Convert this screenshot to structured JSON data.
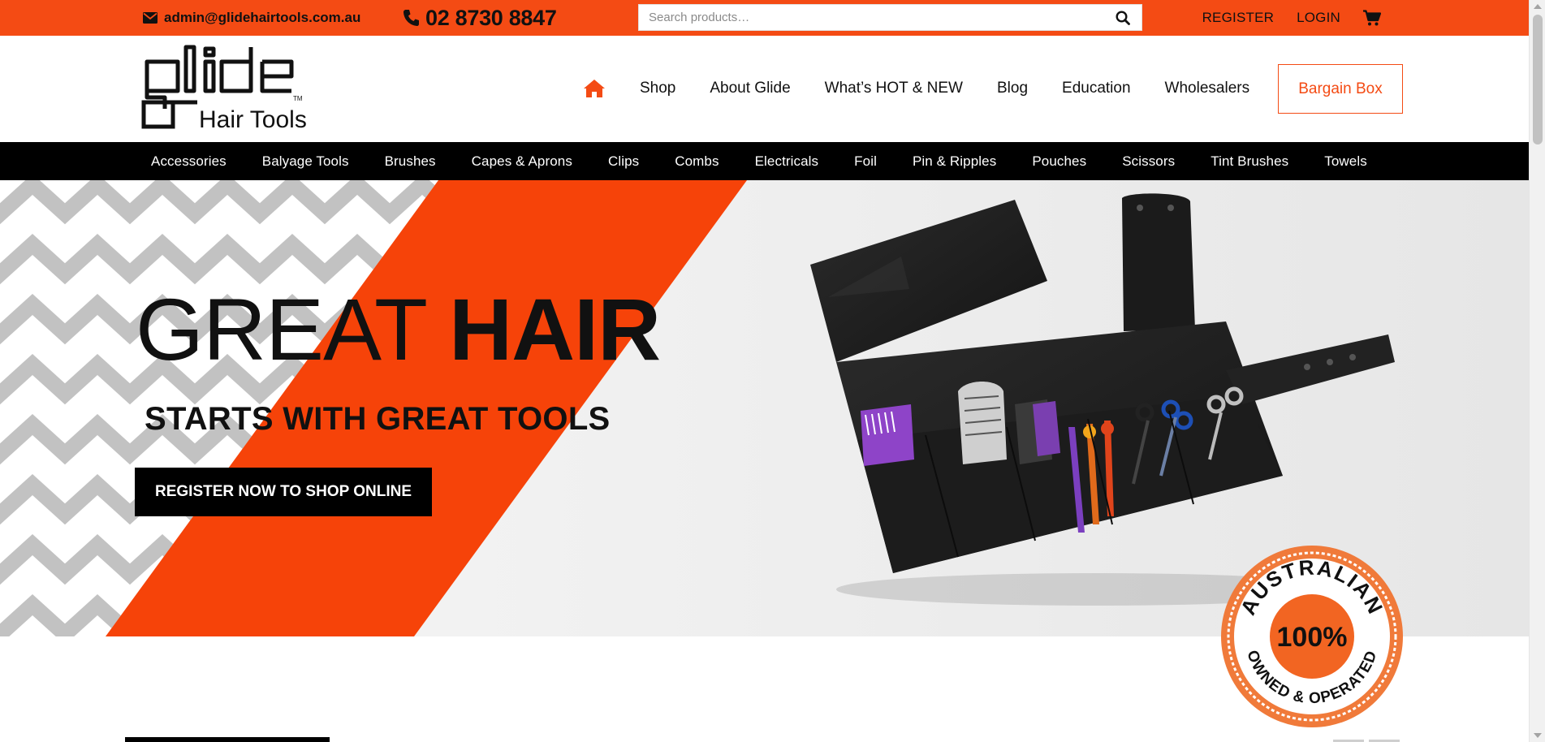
{
  "topbar": {
    "email": "admin@glidehairtools.com.au",
    "phone": "02 8730 8847",
    "search_placeholder": "Search products…",
    "register": "REGISTER",
    "login": "LOGIN",
    "icons": {
      "email": "envelope-icon",
      "phone": "phone-icon",
      "search": "search-icon",
      "cart": "cart-icon"
    }
  },
  "logo": {
    "wordmark": "glide",
    "tagline": "Hair Tools",
    "tm": "TM"
  },
  "main_nav": {
    "home_icon": "home-icon",
    "items": [
      {
        "label": "Shop"
      },
      {
        "label": "About Glide"
      },
      {
        "label": "What’s HOT & NEW"
      },
      {
        "label": "Blog"
      },
      {
        "label": "Education"
      },
      {
        "label": "Wholesalers"
      }
    ],
    "bargain_box": "Bargain Box"
  },
  "categories": [
    "Accessories",
    "Balyage Tools",
    "Brushes",
    "Capes & Aprons",
    "Clips",
    "Combs",
    "Electricals",
    "Foil",
    "Pin & Ripples",
    "Pouches",
    "Scissors",
    "Tint Brushes",
    "Towels"
  ],
  "hero": {
    "title_light": "GREAT ",
    "title_bold": "HAIR",
    "subtitle": "STARTS WITH GREAT TOOLS",
    "cta": "REGISTER NOW TO SHOP ONLINE"
  },
  "badge": {
    "top_text": "AUSTRALIAN",
    "center": "100%",
    "bottom_text": "OWNED & OPERATED"
  },
  "colors": {
    "accent": "#f44b14",
    "black": "#000000",
    "chevron_gray": "#c2c2c2"
  }
}
